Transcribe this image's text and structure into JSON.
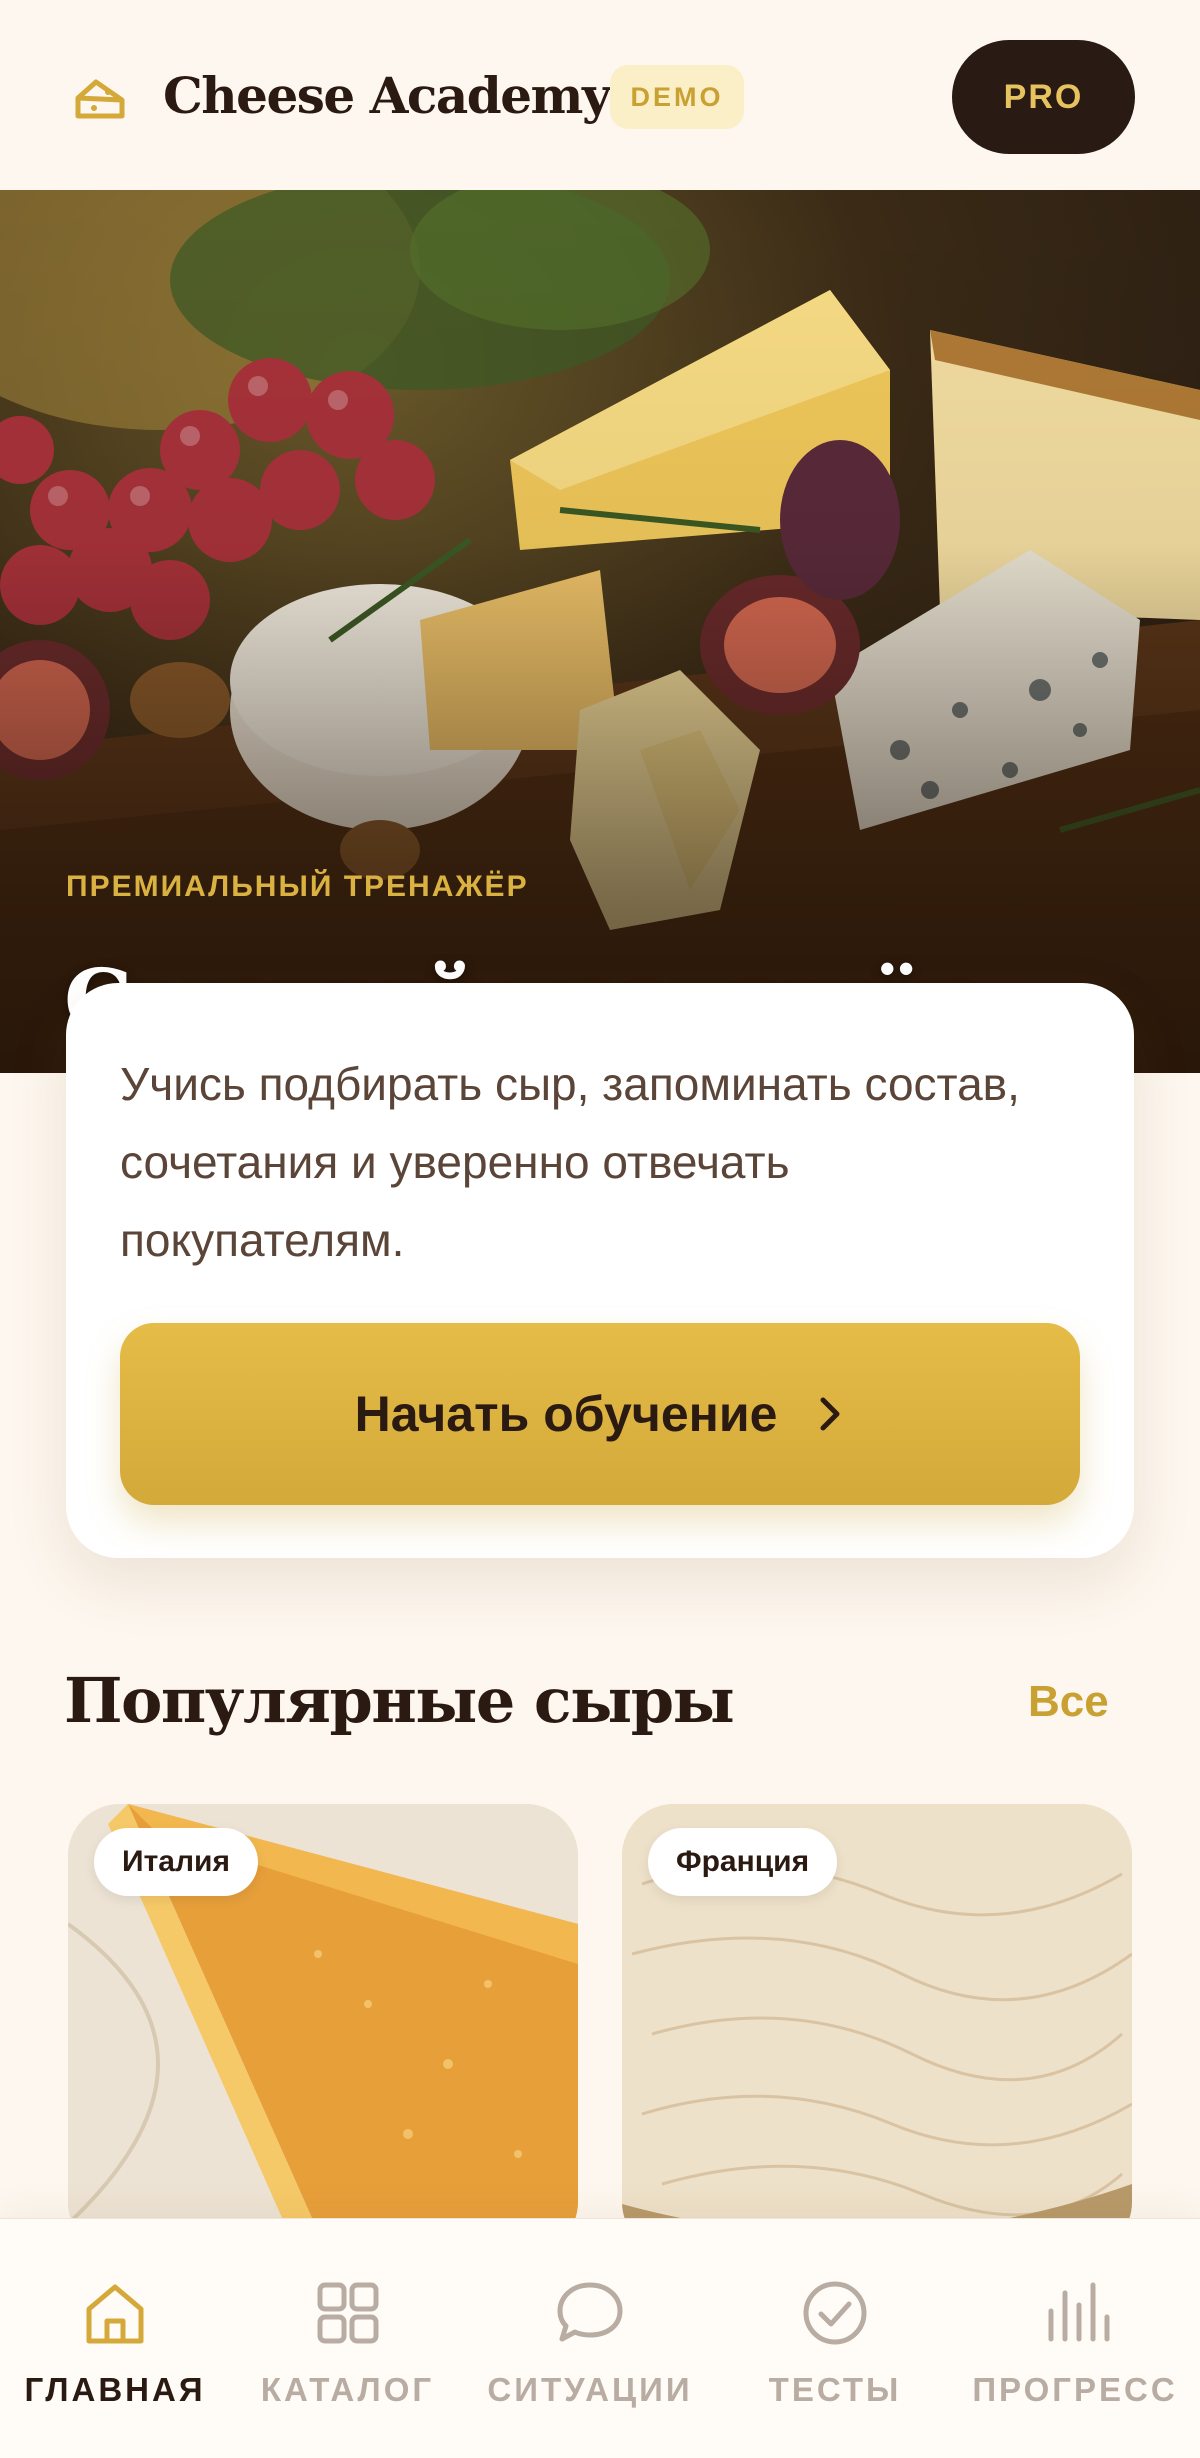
{
  "header": {
    "app_title": "Cheese Academy",
    "demo_badge": "DEMO",
    "pro_button": "PRO"
  },
  "hero": {
    "kicker": "ПРЕМИАЛЬНЫЙ ТРЕНАЖЁР",
    "title": "Сырный тренажёр продавца",
    "description": "Учись подбирать сыр, запоминать состав, сочетания и уверенно отвечать покупателям.",
    "start_button": "Начать обучение"
  },
  "popular": {
    "title": "Популярные сыры",
    "all_link": "Все",
    "cards": [
      {
        "country": "Италия"
      },
      {
        "country": "Франция"
      }
    ]
  },
  "nav": {
    "items": [
      {
        "label": "ГЛАВНАЯ",
        "icon": "home-icon",
        "active": true
      },
      {
        "label": "КАТАЛОГ",
        "icon": "grid-icon",
        "active": false
      },
      {
        "label": "СИТУАЦИИ",
        "icon": "chat-icon",
        "active": false
      },
      {
        "label": "ТЕСТЫ",
        "icon": "check-circle-icon",
        "active": false
      },
      {
        "label": "ПРОГРЕСС",
        "icon": "bar-chart-icon",
        "active": false
      }
    ]
  },
  "colors": {
    "accent_gold": "#d9b241",
    "dark_brown": "#2a1a12",
    "background": "#fdf7ef",
    "inactive_nav": "#b8aca3"
  }
}
